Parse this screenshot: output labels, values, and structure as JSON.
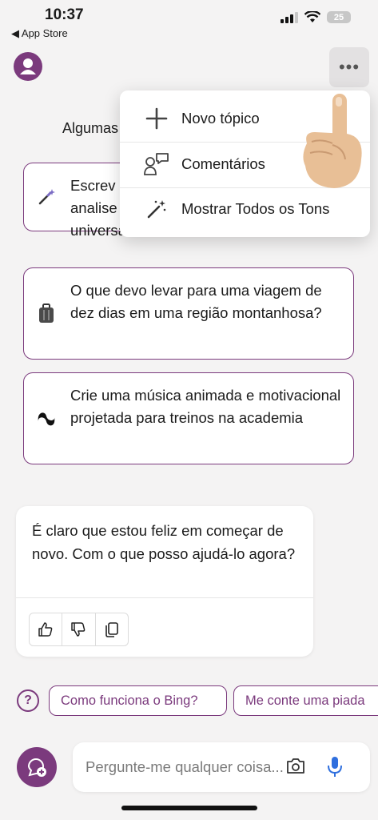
{
  "status_bar": {
    "time": "10:37",
    "back_label": "◀ App Store",
    "battery": "25"
  },
  "header": {
    "more_label": "•••"
  },
  "hint_text": "Algumas",
  "suggestions": [
    {
      "icon": "magic-wand-icon",
      "text": "Escreva uma analise universal"
    },
    {
      "icon": "luggage-icon",
      "text": "O que devo levar para uma viagem de dez dias em uma região montanhosa?"
    },
    {
      "icon": "music-icon",
      "text": "Crie uma música animada e motivacional projetada para treinos na academia"
    }
  ],
  "suggestion_line_1a": "Escrev",
  "suggestion_line_1b": "analise",
  "suggestion_line_1c": "universal",
  "reply": {
    "text": "É claro que estou feliz em começar de novo. Com o que posso ajudá-lo agora?"
  },
  "chips": {
    "help": "?",
    "c1": "Como funciona o Bing?",
    "c2": "Me conte uma piada"
  },
  "input": {
    "placeholder": "Pergunte-me qualquer coisa..."
  },
  "menu": {
    "items": [
      {
        "label": "Novo tópico",
        "icon": "plus-icon"
      },
      {
        "label": "Comentários",
        "icon": "feedback-icon"
      },
      {
        "label": "Mostrar Todos os Tons",
        "icon": "magic-wand-icon"
      }
    ]
  },
  "colors": {
    "accent": "#7b3a7d",
    "background": "#f4f3f3",
    "mic": "#2f6fde"
  }
}
